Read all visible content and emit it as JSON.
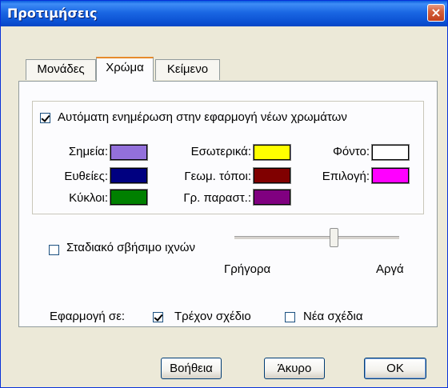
{
  "window": {
    "title": "Προτιμήσεις",
    "close_glyph": "×"
  },
  "tabs": [
    {
      "label": "Μονάδες",
      "active": false
    },
    {
      "label": "Χρώμα",
      "active": true
    },
    {
      "label": "Κείμενο",
      "active": false
    }
  ],
  "color_group": {
    "auto_update": {
      "label": "Αυτόματη ενημέρωση στην εφαρμογή νέων χρωμάτων",
      "checked": true
    },
    "swatches": {
      "points": {
        "label": "Σημεία:",
        "color": "#9370db"
      },
      "lines": {
        "label": "Ευθείες:",
        "color": "#000080"
      },
      "circles": {
        "label": "Κύκλοι:",
        "color": "#008000"
      },
      "interior": {
        "label": "Εσωτερικά:",
        "color": "#ffff00"
      },
      "loci": {
        "label": "Γεωμ. τόποι:",
        "color": "#800000"
      },
      "graphs": {
        "label": "Γρ. παραστ.:",
        "color": "#800080"
      },
      "background": {
        "label": "Φόντο:",
        "color": "#ffffff"
      },
      "selection": {
        "label": "Επιλογή:",
        "color": "#ff00ff"
      }
    }
  },
  "trace_fade": {
    "label": "Σταδιακό σβήσιμο ιχνών",
    "checked": false,
    "min_label": "Γρήγορα",
    "max_label": "Αργά",
    "value": 0.6
  },
  "apply_to": {
    "label": "Εφαρμογή σε:",
    "current": {
      "label": "Τρέχον σχέδιο",
      "checked": true
    },
    "new": {
      "label": "Νέα σχέδια",
      "checked": false
    }
  },
  "buttons": {
    "help": "Βοήθεια",
    "cancel": "Άκυρο",
    "ok": "OK"
  }
}
